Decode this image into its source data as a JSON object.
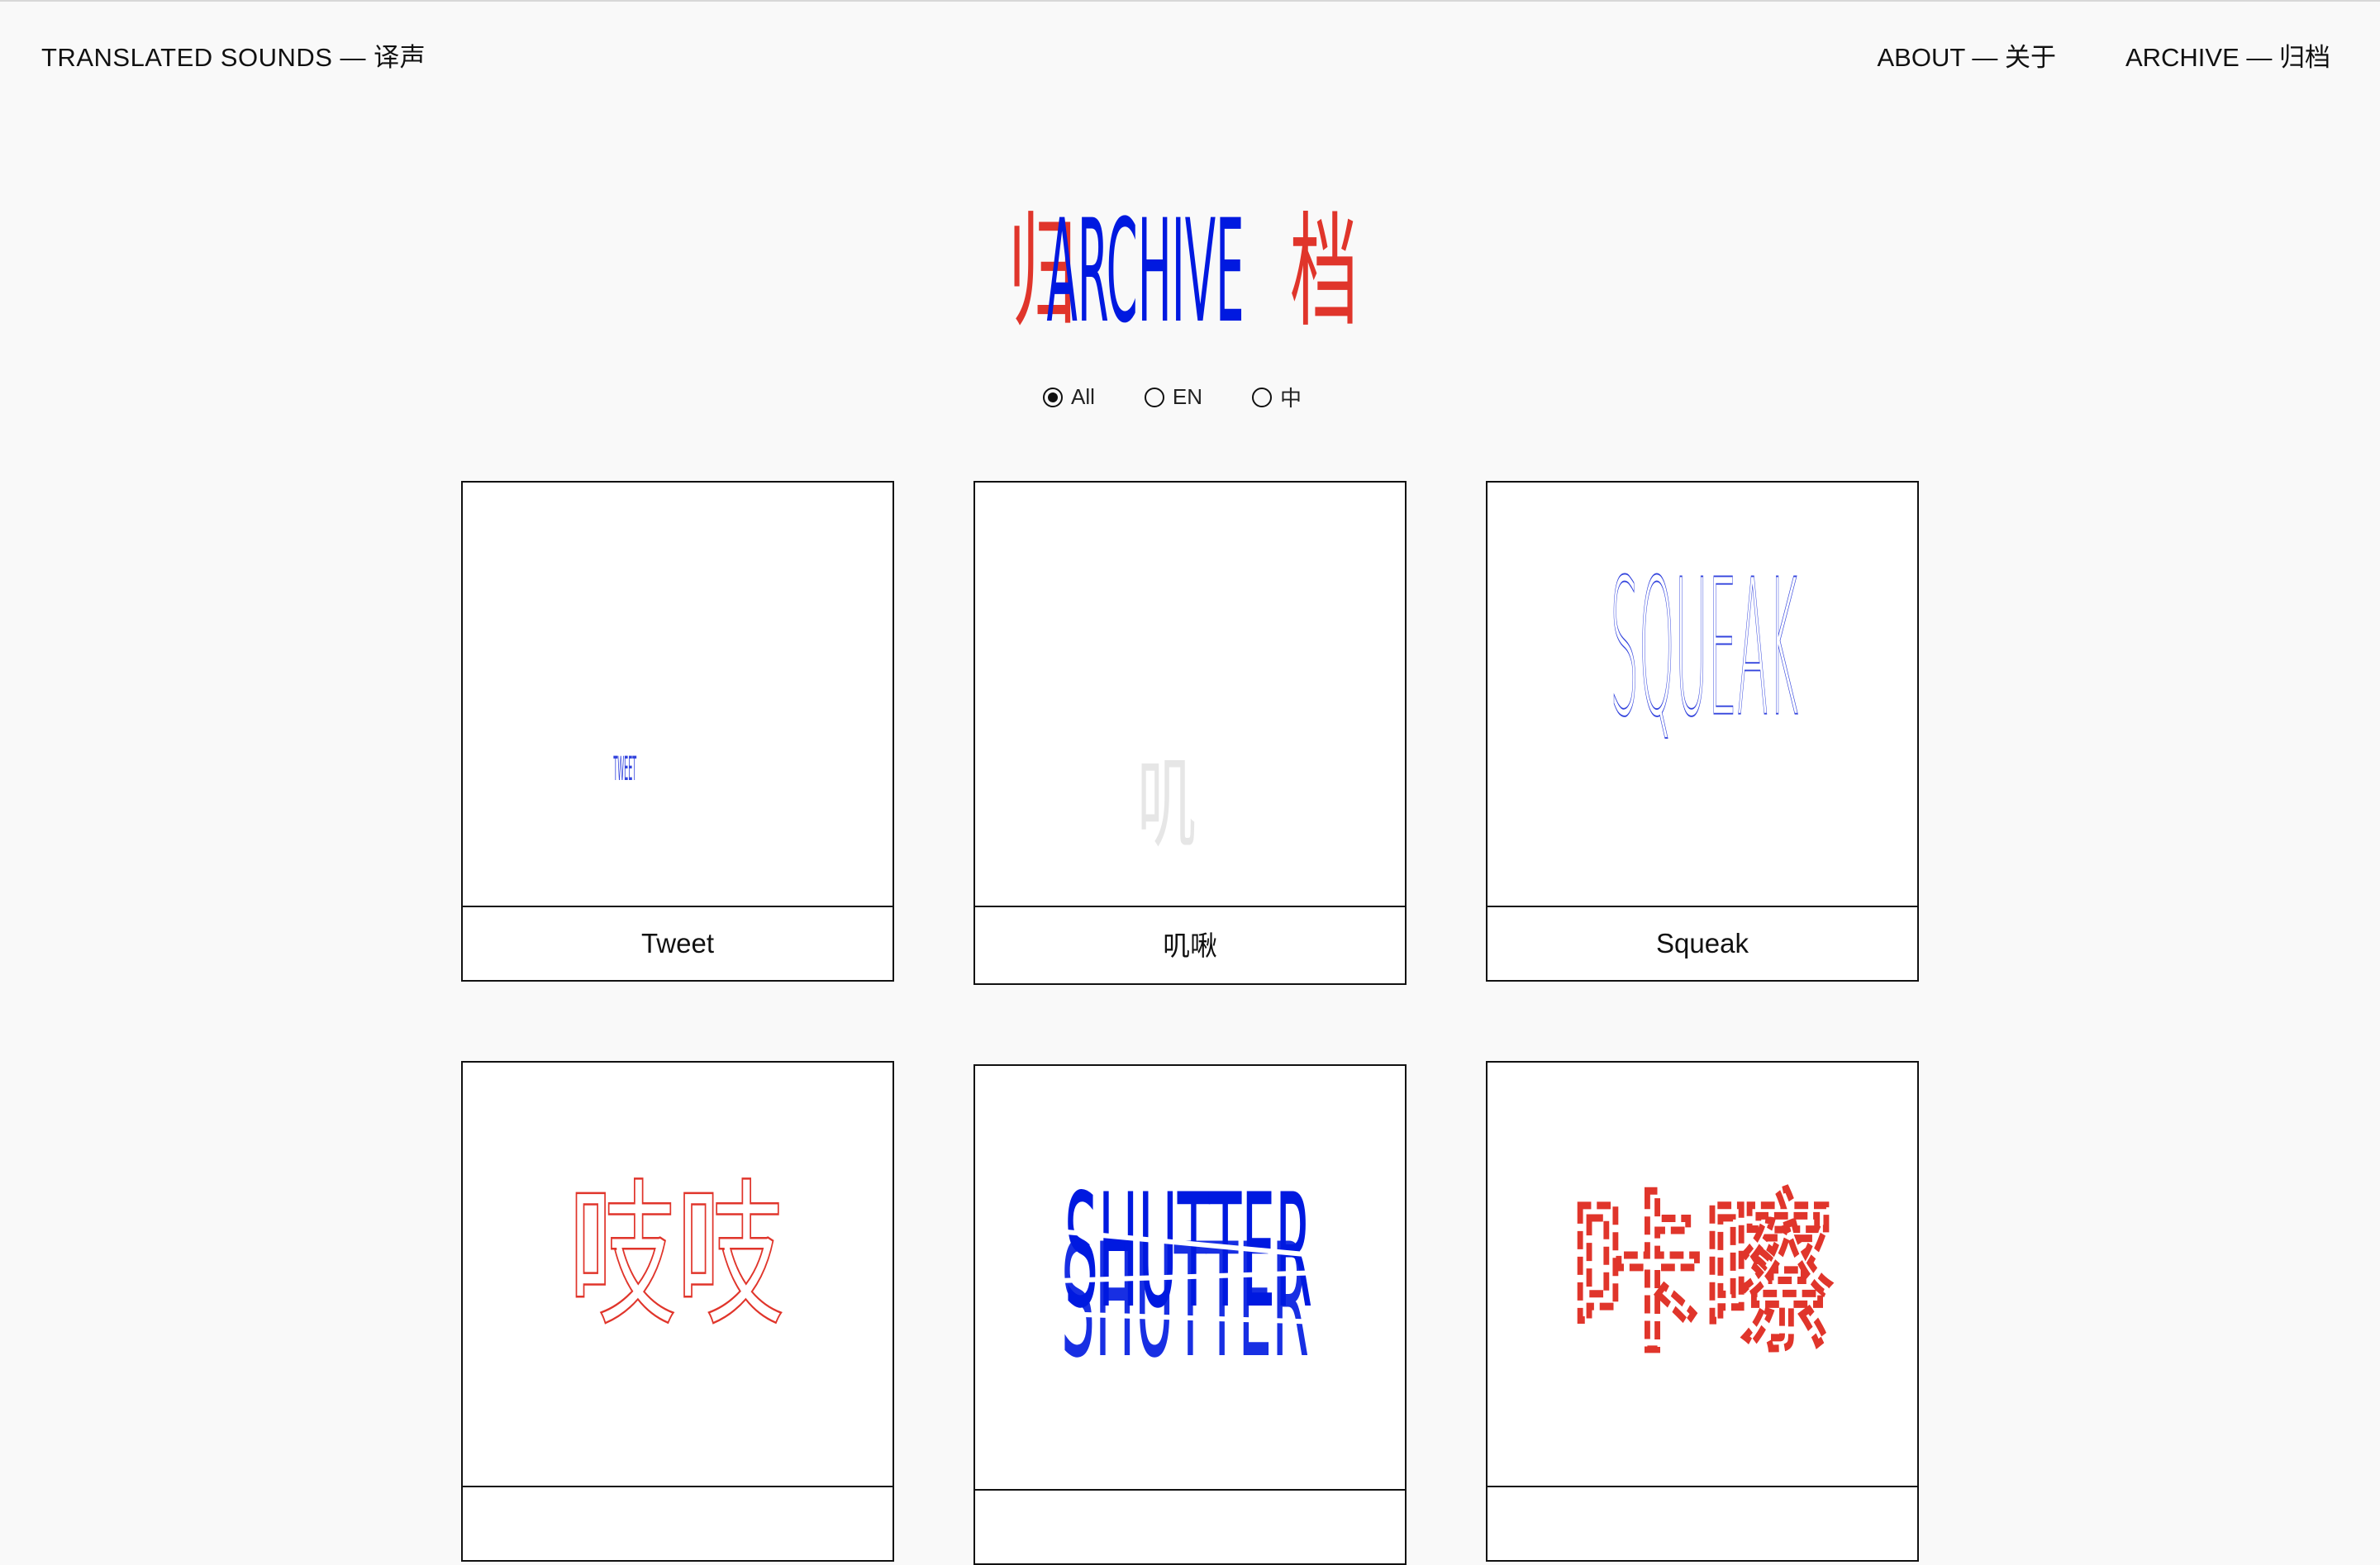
{
  "header": {
    "site_title": "TRANSLATED SOUNDS — 译声",
    "nav": [
      {
        "label": "ABOUT — 关于"
      },
      {
        "label": "ARCHIVE — 归档"
      }
    ]
  },
  "page_heading": {
    "left_glyph": "归",
    "word": "ARCHIVE",
    "right_glyph": "档"
  },
  "filters": {
    "selected": "All",
    "options": [
      {
        "label": "All",
        "selected": true
      },
      {
        "label": "EN",
        "selected": false
      },
      {
        "label": "中",
        "selected": false
      }
    ]
  },
  "cards": [
    {
      "label": "Tweet",
      "art_text": "TWEET"
    },
    {
      "label": "叽啾",
      "art_text": "叽"
    },
    {
      "label": "Squeak",
      "art_text": "SQUEAK"
    },
    {
      "label": "",
      "art_text": "吱吱"
    },
    {
      "label": "",
      "art_text": "SHUTTER"
    },
    {
      "label": "",
      "art_text": "咔嚓"
    }
  ],
  "colors": {
    "blue": "#0019e0",
    "red": "#e0352b",
    "background": "#f9f9f9"
  }
}
